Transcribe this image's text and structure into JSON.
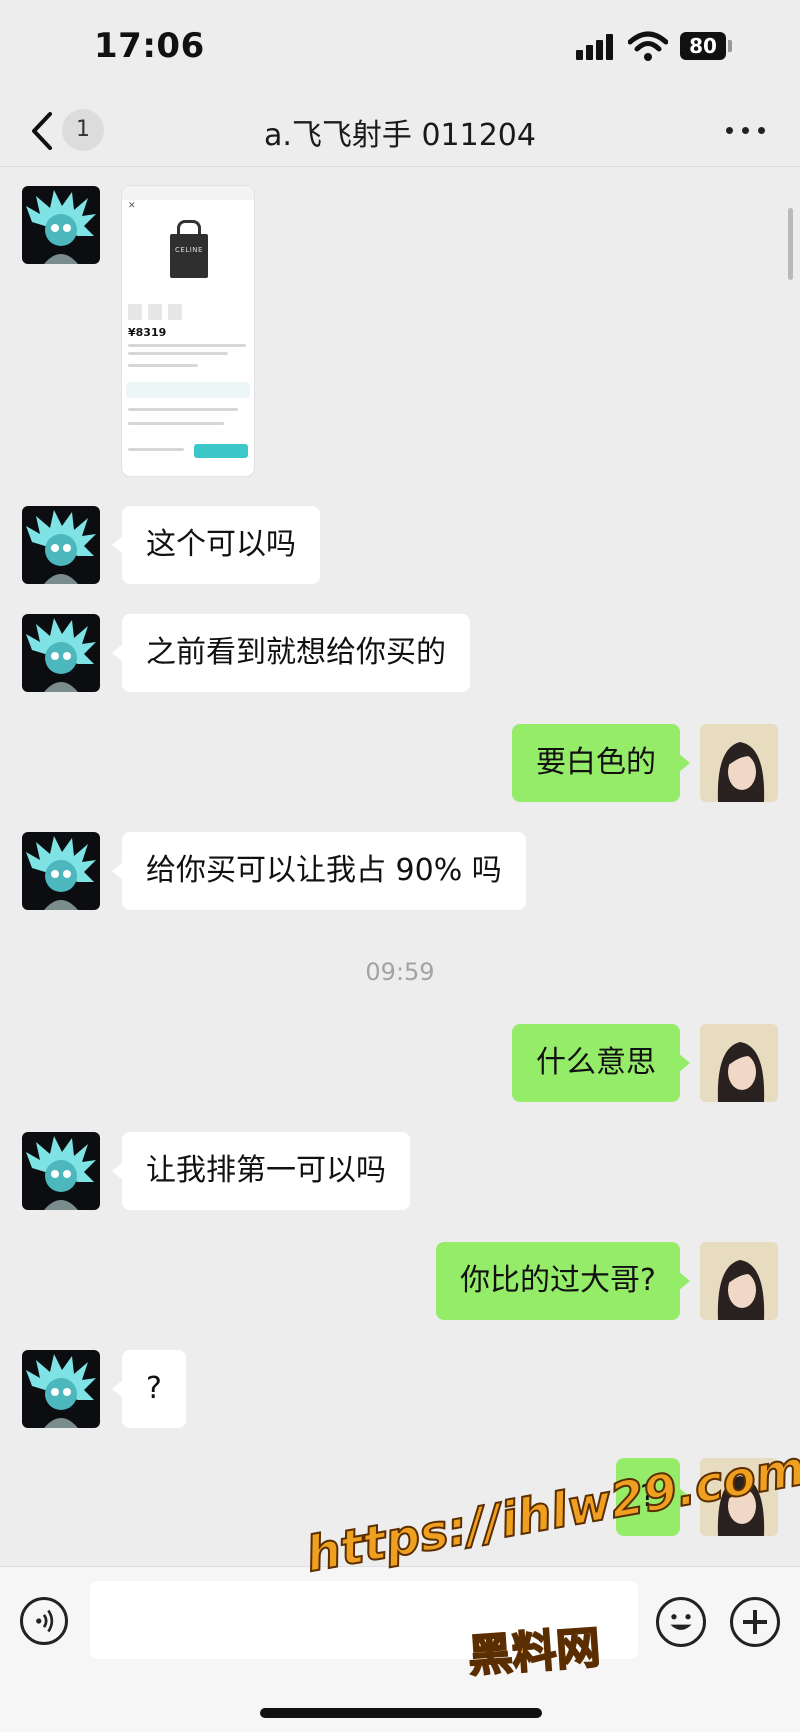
{
  "status_bar": {
    "time": "17:06",
    "battery": "80"
  },
  "nav": {
    "unread_count": "1",
    "title": "a.飞飞射手 011204"
  },
  "shared_image": {
    "brand": "CELINE",
    "price": "¥8319"
  },
  "messages": {
    "m1": "这个可以吗",
    "m2": "之前看到就想给你买的",
    "m3": "要白色的",
    "m4": "给你买可以让我占 90% 吗",
    "timestamp": "09:59",
    "m5": "什么意思",
    "m6": "让我排第一可以吗",
    "m7": "你比的过大哥?",
    "m8": "?",
    "m9": "?"
  },
  "watermark": {
    "url": "https://ihlw29.com",
    "name": "黑料网"
  },
  "colors": {
    "outgoing_bubble": "#95ec69",
    "incoming_bubble": "#ffffff",
    "background": "#ededed"
  }
}
